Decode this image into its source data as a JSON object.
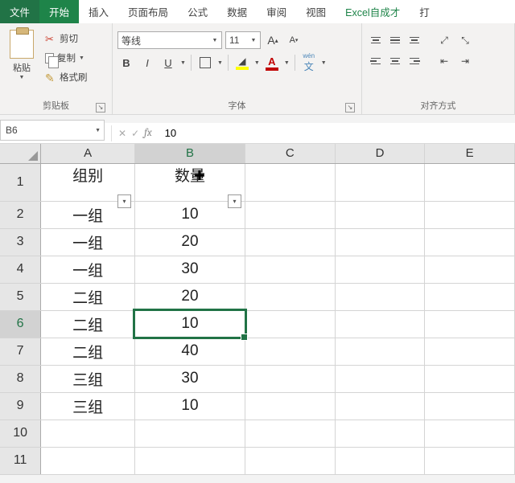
{
  "menu": {
    "file": "文件",
    "active": "开始",
    "items": [
      "插入",
      "页面布局",
      "公式",
      "数据",
      "审阅",
      "视图"
    ],
    "custom": "Excel自成才",
    "last": "打"
  },
  "clipboard": {
    "paste": "粘贴",
    "cut": "剪切",
    "copy": "复制",
    "format_painter": "格式刷",
    "group_label": "剪贴板"
  },
  "font": {
    "name": "等线",
    "size": "11",
    "bold": "B",
    "italic": "I",
    "underline": "U",
    "wen": "wén",
    "group_label": "字体"
  },
  "align": {
    "group_label": "对齐方式"
  },
  "namebox": "B6",
  "formula_value": "10",
  "columns": [
    "A",
    "B",
    "C",
    "D",
    "E"
  ],
  "active_col": "B",
  "active_row": 6,
  "headers": {
    "a": "组别",
    "b": "数量"
  },
  "rows": [
    {
      "a": "一组",
      "b": "10"
    },
    {
      "a": "一组",
      "b": "20"
    },
    {
      "a": "一组",
      "b": "30"
    },
    {
      "a": "二组",
      "b": "20"
    },
    {
      "a": "二组",
      "b": "10"
    },
    {
      "a": "二组",
      "b": "40"
    },
    {
      "a": "三组",
      "b": "30"
    },
    {
      "a": "三组",
      "b": "10"
    }
  ]
}
